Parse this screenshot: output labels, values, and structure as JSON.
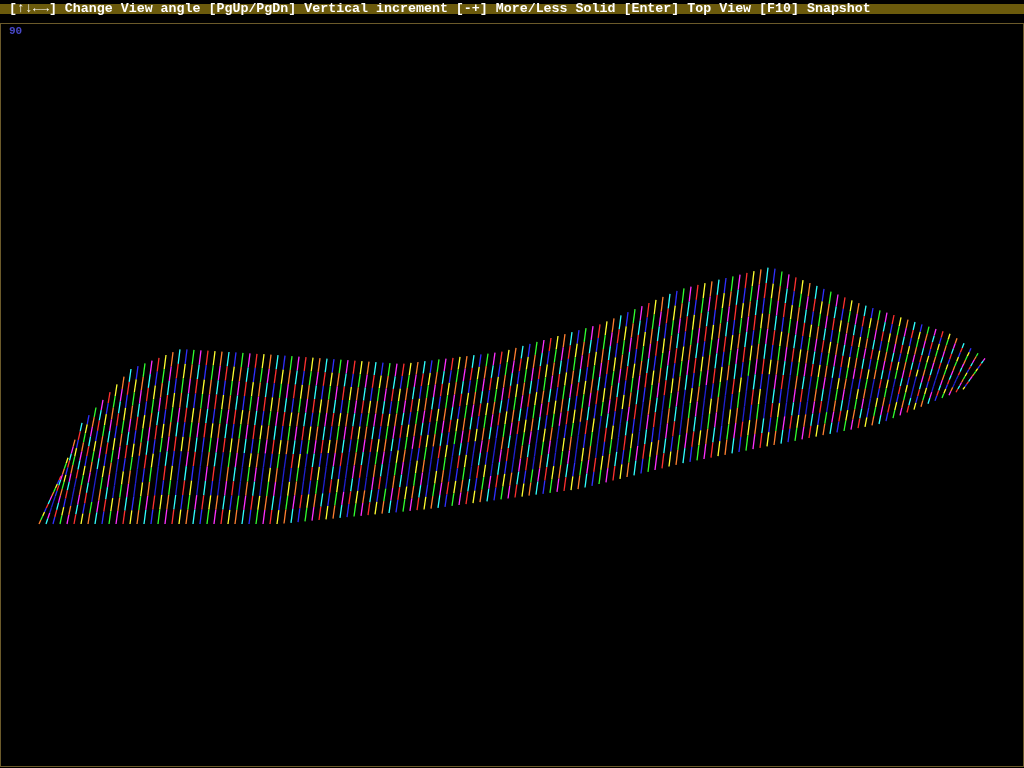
{
  "help_bar": {
    "text": "[↑↓←→] Change View angle [PgUp/PgDn] Vertical increment [-+] More/Less Solid [Enter] Top View [F10] Snapshot"
  },
  "view": {
    "angle": "90"
  }
}
